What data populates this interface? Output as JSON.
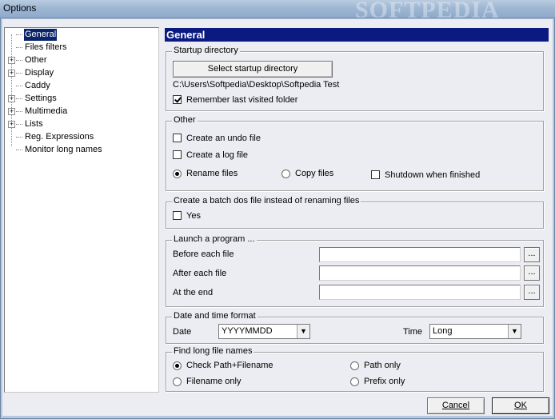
{
  "window": {
    "title": "Options",
    "watermark": "SOFTPEDIA"
  },
  "tree": {
    "items": [
      {
        "label": "General",
        "expandable": false,
        "selected": true
      },
      {
        "label": "Files filters",
        "expandable": false
      },
      {
        "label": "Other",
        "expandable": true
      },
      {
        "label": "Display",
        "expandable": true
      },
      {
        "label": "Caddy",
        "expandable": false
      },
      {
        "label": "Settings",
        "expandable": true
      },
      {
        "label": "Multimedia",
        "expandable": true
      },
      {
        "label": "Lists",
        "expandable": true
      },
      {
        "label": "Reg. Expressions",
        "expandable": false
      },
      {
        "label": "Monitor long names",
        "expandable": false
      }
    ],
    "expand_glyph": "+"
  },
  "header": {
    "title": "General"
  },
  "startup": {
    "legend": "Startup directory",
    "select_button": "Select startup directory",
    "path": "C:\\Users\\Softpedia\\Desktop\\Softpedia Test",
    "remember_label": "Remember last visited folder",
    "remember_checked": true
  },
  "other": {
    "legend": "Other",
    "undo_label": "Create an undo file",
    "log_label": "Create a log file",
    "rename_label": "Rename files",
    "copy_label": "Copy files",
    "shutdown_label": "Shutdown when finished",
    "mode": "rename"
  },
  "batch": {
    "legend": "Create a batch dos file instead of renaming files",
    "yes_label": "Yes"
  },
  "launch": {
    "legend": "Launch a program ...",
    "before_label": "Before each file",
    "after_label": "After each file",
    "end_label": "At the end",
    "browse_label": "..."
  },
  "datetime": {
    "legend": "Date and time format",
    "date_label": "Date",
    "date_value": "YYYYMMDD",
    "time_label": "Time",
    "time_value": "Long",
    "arrow": "▼"
  },
  "longnames": {
    "legend": "Find long file names",
    "check_path_filename": "Check Path+Filename",
    "path_only": "Path only",
    "filename_only": "Filename only",
    "prefix_only": "Prefix only",
    "selected": "check_path_filename"
  },
  "footer": {
    "cancel": "Cancel",
    "ok": "OK"
  }
}
